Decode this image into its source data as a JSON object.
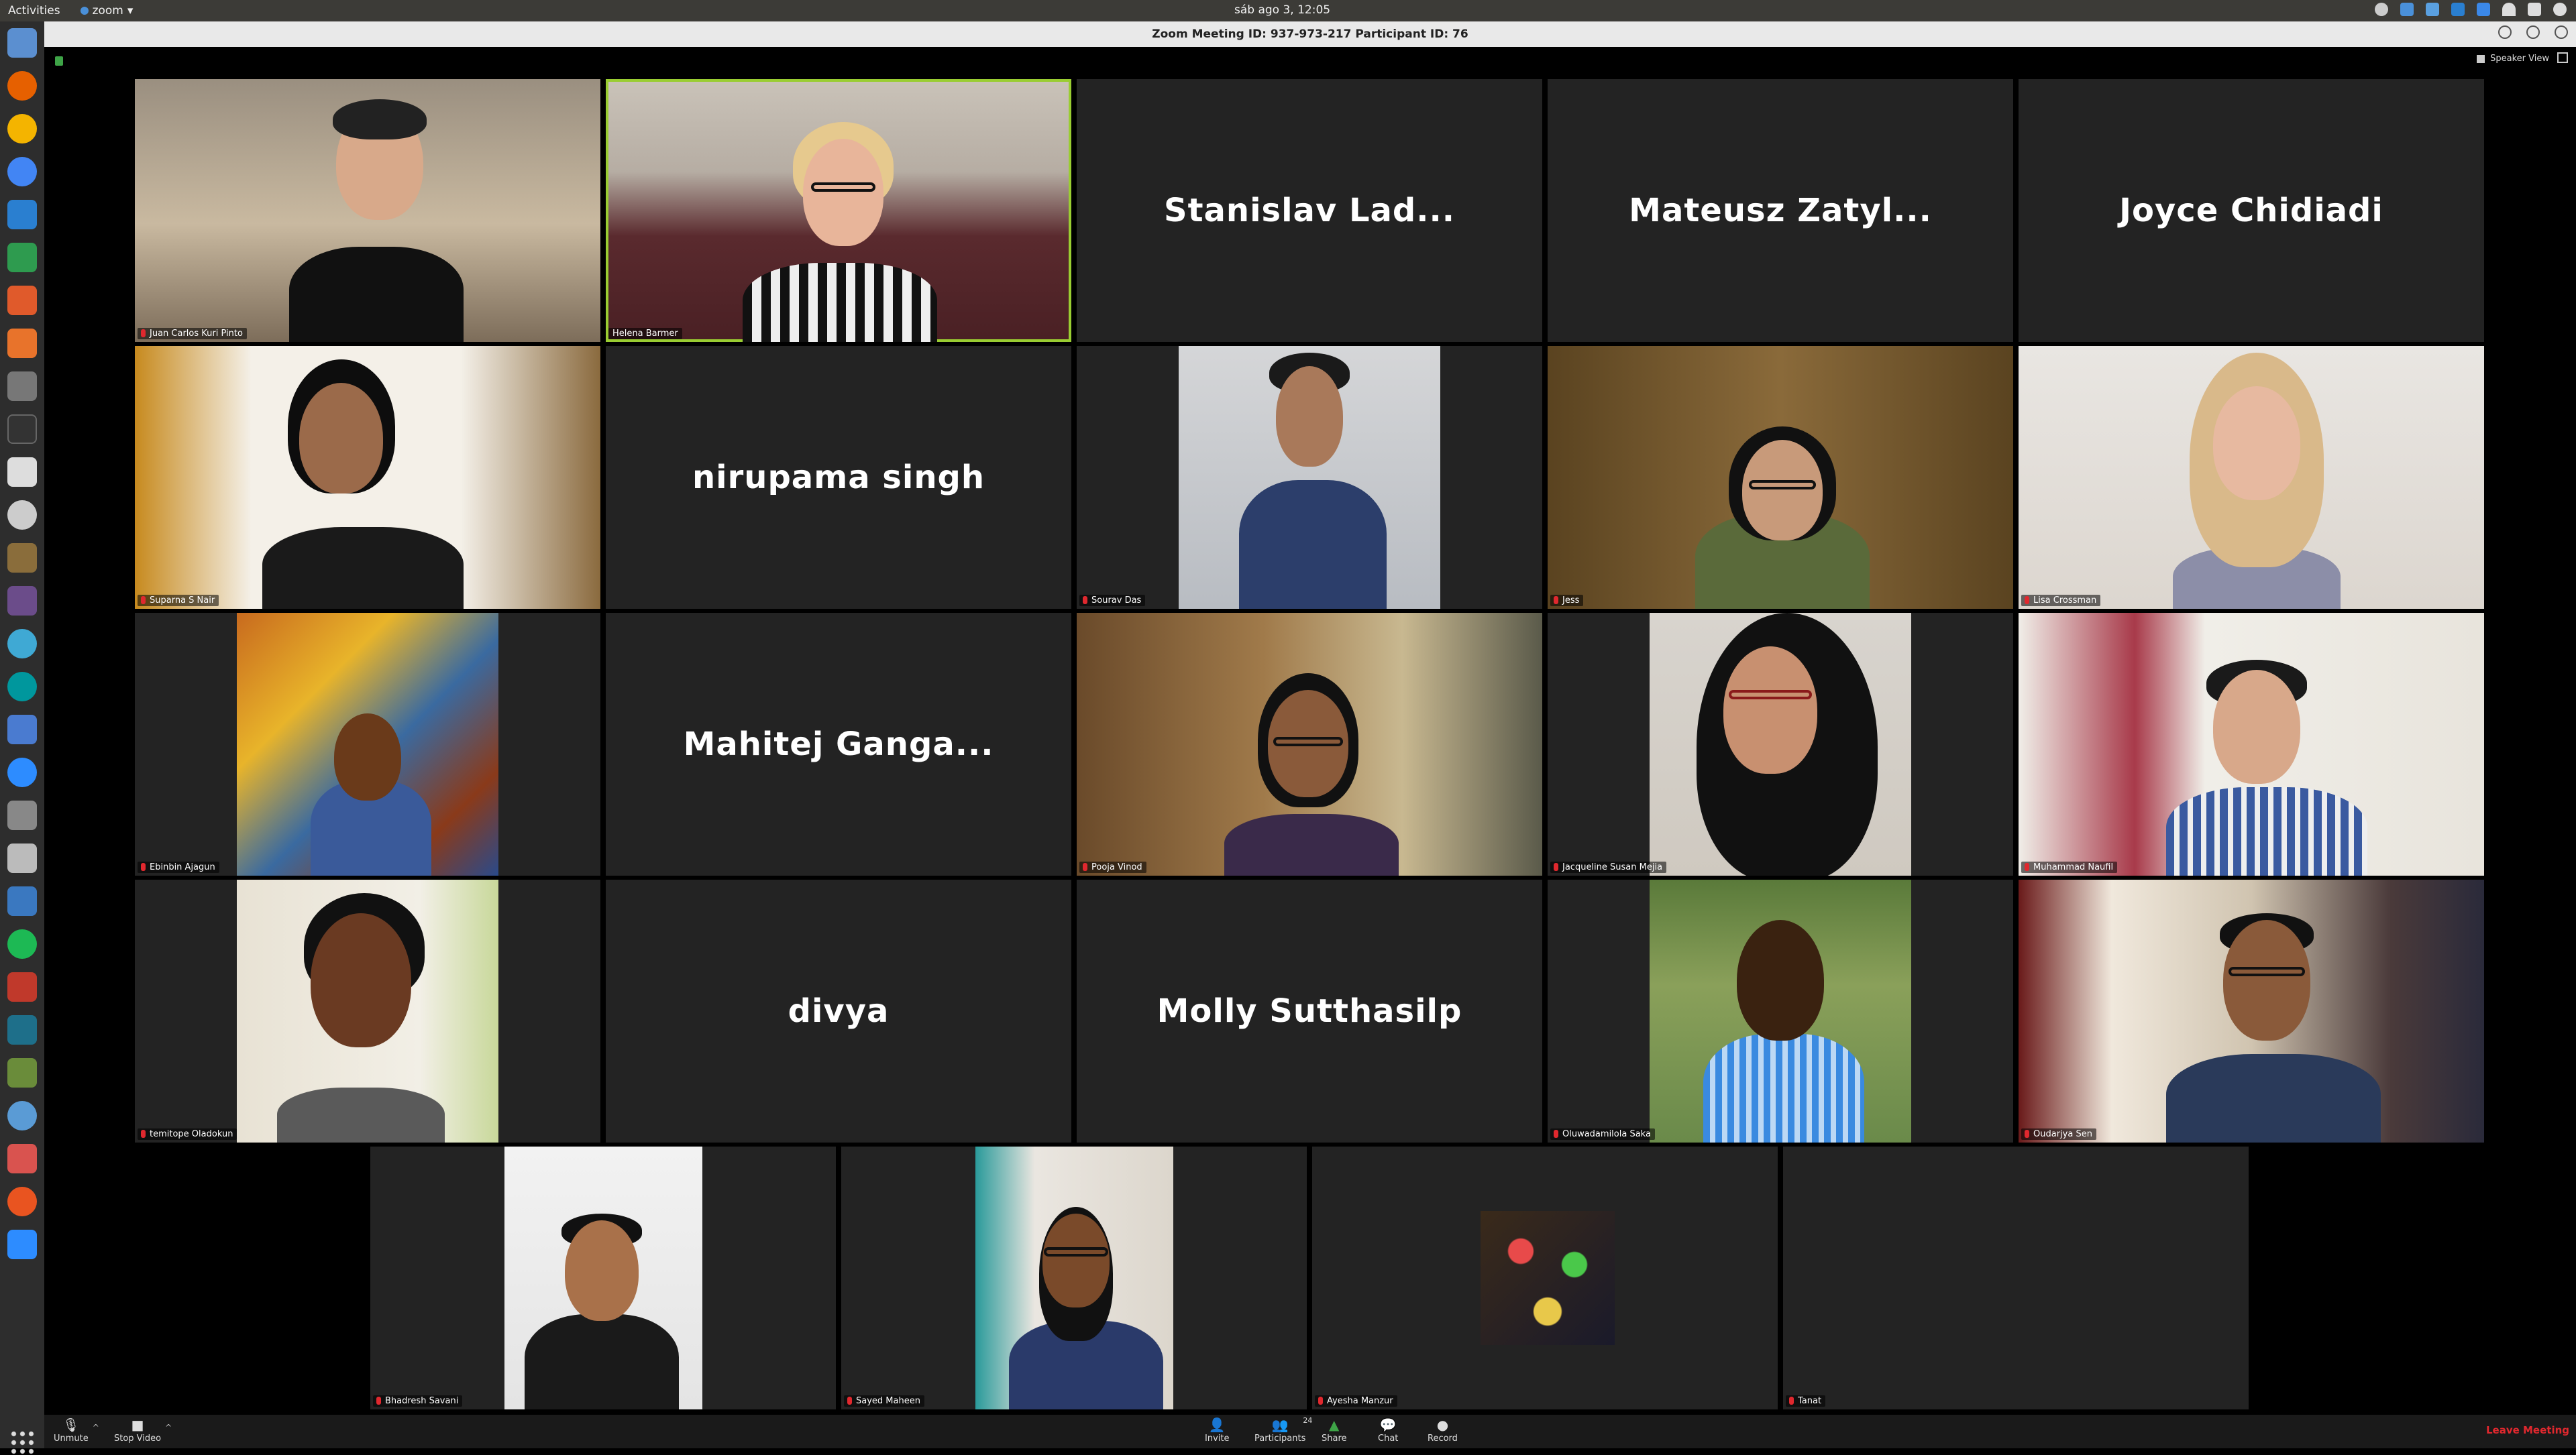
{
  "topbar": {
    "activities": "Activities",
    "app_name": "zoom",
    "app_menu_caret": "▾",
    "clock": "sáb ago  3, 12:05"
  },
  "window": {
    "title": "Zoom Meeting ID: 937-973-217 Participant ID: 76"
  },
  "view_controls": {
    "speaker_view": "Speaker View"
  },
  "tiles": [
    {
      "name": "Juan Carlos Kuri Pinto",
      "video": true,
      "muted": true
    },
    {
      "name": "Helena Barmer",
      "video": true,
      "muted": false,
      "active_speaker": true
    },
    {
      "name": "Stanislav Lad...",
      "video": false
    },
    {
      "name": "Mateusz Zatyl...",
      "video": false
    },
    {
      "name": "Joyce Chidiadi",
      "video": false
    },
    {
      "name": "Suparna S Nair",
      "video": true,
      "muted": true
    },
    {
      "name": "nirupama singh",
      "video": false
    },
    {
      "name": "Sourav Das",
      "video": true,
      "muted": true
    },
    {
      "name": "Jess",
      "video": true,
      "muted": true
    },
    {
      "name": "Lisa Crossman",
      "video": true,
      "muted": true
    },
    {
      "name": "Ebinbin Ajagun",
      "video": true,
      "muted": true
    },
    {
      "name": "Mahitej Ganga...",
      "video": false
    },
    {
      "name": "Pooja Vinod",
      "video": true,
      "muted": true
    },
    {
      "name": "Jacqueline Susan Mejia",
      "video": true,
      "muted": true
    },
    {
      "name": "Muhammad Naufil",
      "video": true,
      "muted": true
    },
    {
      "name": "temitope Oladokun",
      "video": true,
      "muted": true
    },
    {
      "name": "divya",
      "video": false
    },
    {
      "name": "Molly Sutthasilp",
      "video": false
    },
    {
      "name": "Oluwadamilola Saka",
      "video": true,
      "muted": true
    },
    {
      "name": "Oudarjya Sen",
      "video": true,
      "muted": true
    },
    {
      "name": "Bhadresh Savani",
      "video": true,
      "muted": true
    },
    {
      "name": "Sayed Maheen",
      "video": true,
      "muted": true
    },
    {
      "name": "Ayesha Manzur",
      "video": true,
      "muted": true
    },
    {
      "name": "Tanat",
      "video": false,
      "muted": true
    }
  ],
  "controls": {
    "unmute": "Unmute",
    "stop_video": "Stop Video",
    "invite": "Invite",
    "participants": "Participants",
    "participants_count": "24",
    "share": "Share",
    "chat": "Chat",
    "record": "Record",
    "leave": "Leave Meeting"
  },
  "colors": {
    "active_speaker_border": "#9acd32",
    "muted_icon": "#e0282e",
    "share_icon": "#3ea447",
    "tile_bg": "#232323"
  }
}
